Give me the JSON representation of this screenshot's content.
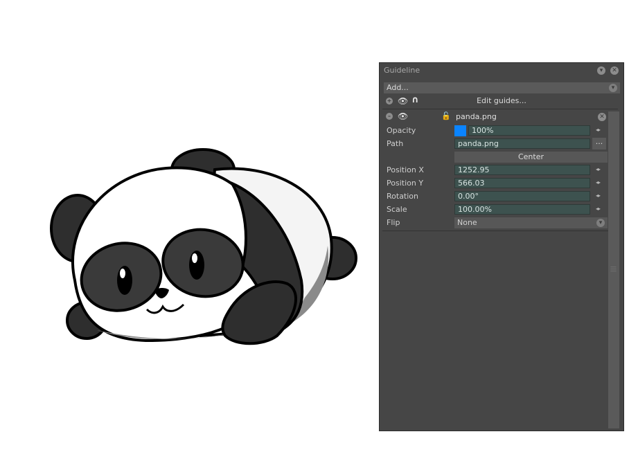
{
  "panel": {
    "title": "Guideline",
    "add_label": "Add...",
    "edit_guides_label": "Edit guides...",
    "layer": {
      "name": "panda.png"
    },
    "properties": {
      "opacity": {
        "label": "Opacity",
        "value": "100%",
        "color": "#0a84ff"
      },
      "path": {
        "label": "Path",
        "value": "panda.png",
        "browse": "..."
      },
      "center_label": "Center",
      "position_x": {
        "label": "Position X",
        "value": "1252.95"
      },
      "position_y": {
        "label": "Position Y",
        "value": "566.03"
      },
      "rotation": {
        "label": "Rotation",
        "value": "0.00°"
      },
      "scale": {
        "label": "Scale",
        "value": "100.00%"
      },
      "flip": {
        "label": "Flip",
        "value": "None"
      }
    }
  },
  "icons": [
    "minimize-icon",
    "close-icon",
    "eye-icon",
    "magnet-icon",
    "unlock-icon",
    "dropdown-icon",
    "arrows-icon"
  ]
}
